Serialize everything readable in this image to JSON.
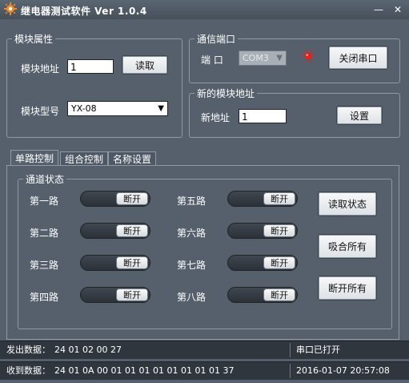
{
  "window": {
    "title": "继电器测试软件  Ver 1.0.4",
    "minimize_glyph": "—",
    "close_glyph": "✕",
    "icon": "gear-icon"
  },
  "module_props": {
    "legend": "模块属性",
    "address_label": "模块地址",
    "address_value": "1",
    "read_button": "读取",
    "model_label": "模块型号",
    "model_value": "YX-08"
  },
  "serial_port": {
    "legend": "通信端口",
    "port_label": "端 口",
    "port_value": "COM3",
    "close_button": "关闭串口",
    "led_color": "#e3231b"
  },
  "new_address": {
    "legend": "新的模块地址",
    "label": "新地址",
    "value": "1",
    "set_button": "设置"
  },
  "tabs": [
    {
      "label": "单路控制",
      "active": true
    },
    {
      "label": "组合控制",
      "active": false
    },
    {
      "label": "名称设置",
      "active": false
    }
  ],
  "channel_state": {
    "legend": "通道状态",
    "channels": [
      {
        "label": "第一路",
        "state": "断开"
      },
      {
        "label": "第二路",
        "state": "断开"
      },
      {
        "label": "第三路",
        "state": "断开"
      },
      {
        "label": "第四路",
        "state": "断开"
      },
      {
        "label": "第五路",
        "state": "断开"
      },
      {
        "label": "第六路",
        "state": "断开"
      },
      {
        "label": "第七路",
        "state": "断开"
      },
      {
        "label": "第八路",
        "state": "断开"
      }
    ],
    "read_state_button": "读取状态",
    "close_all_button": "吸合所有",
    "open_all_button": "断开所有"
  },
  "status": {
    "sent_label": "发出数据：",
    "sent_data": "24 01 02 00 27",
    "port_status": "串口已打开",
    "recv_label": "收到数据：",
    "recv_data": "24 01 0A 00 01 01 01 01 01 01 01 01 37",
    "datetime": "2016-01-07  20:57:08"
  }
}
